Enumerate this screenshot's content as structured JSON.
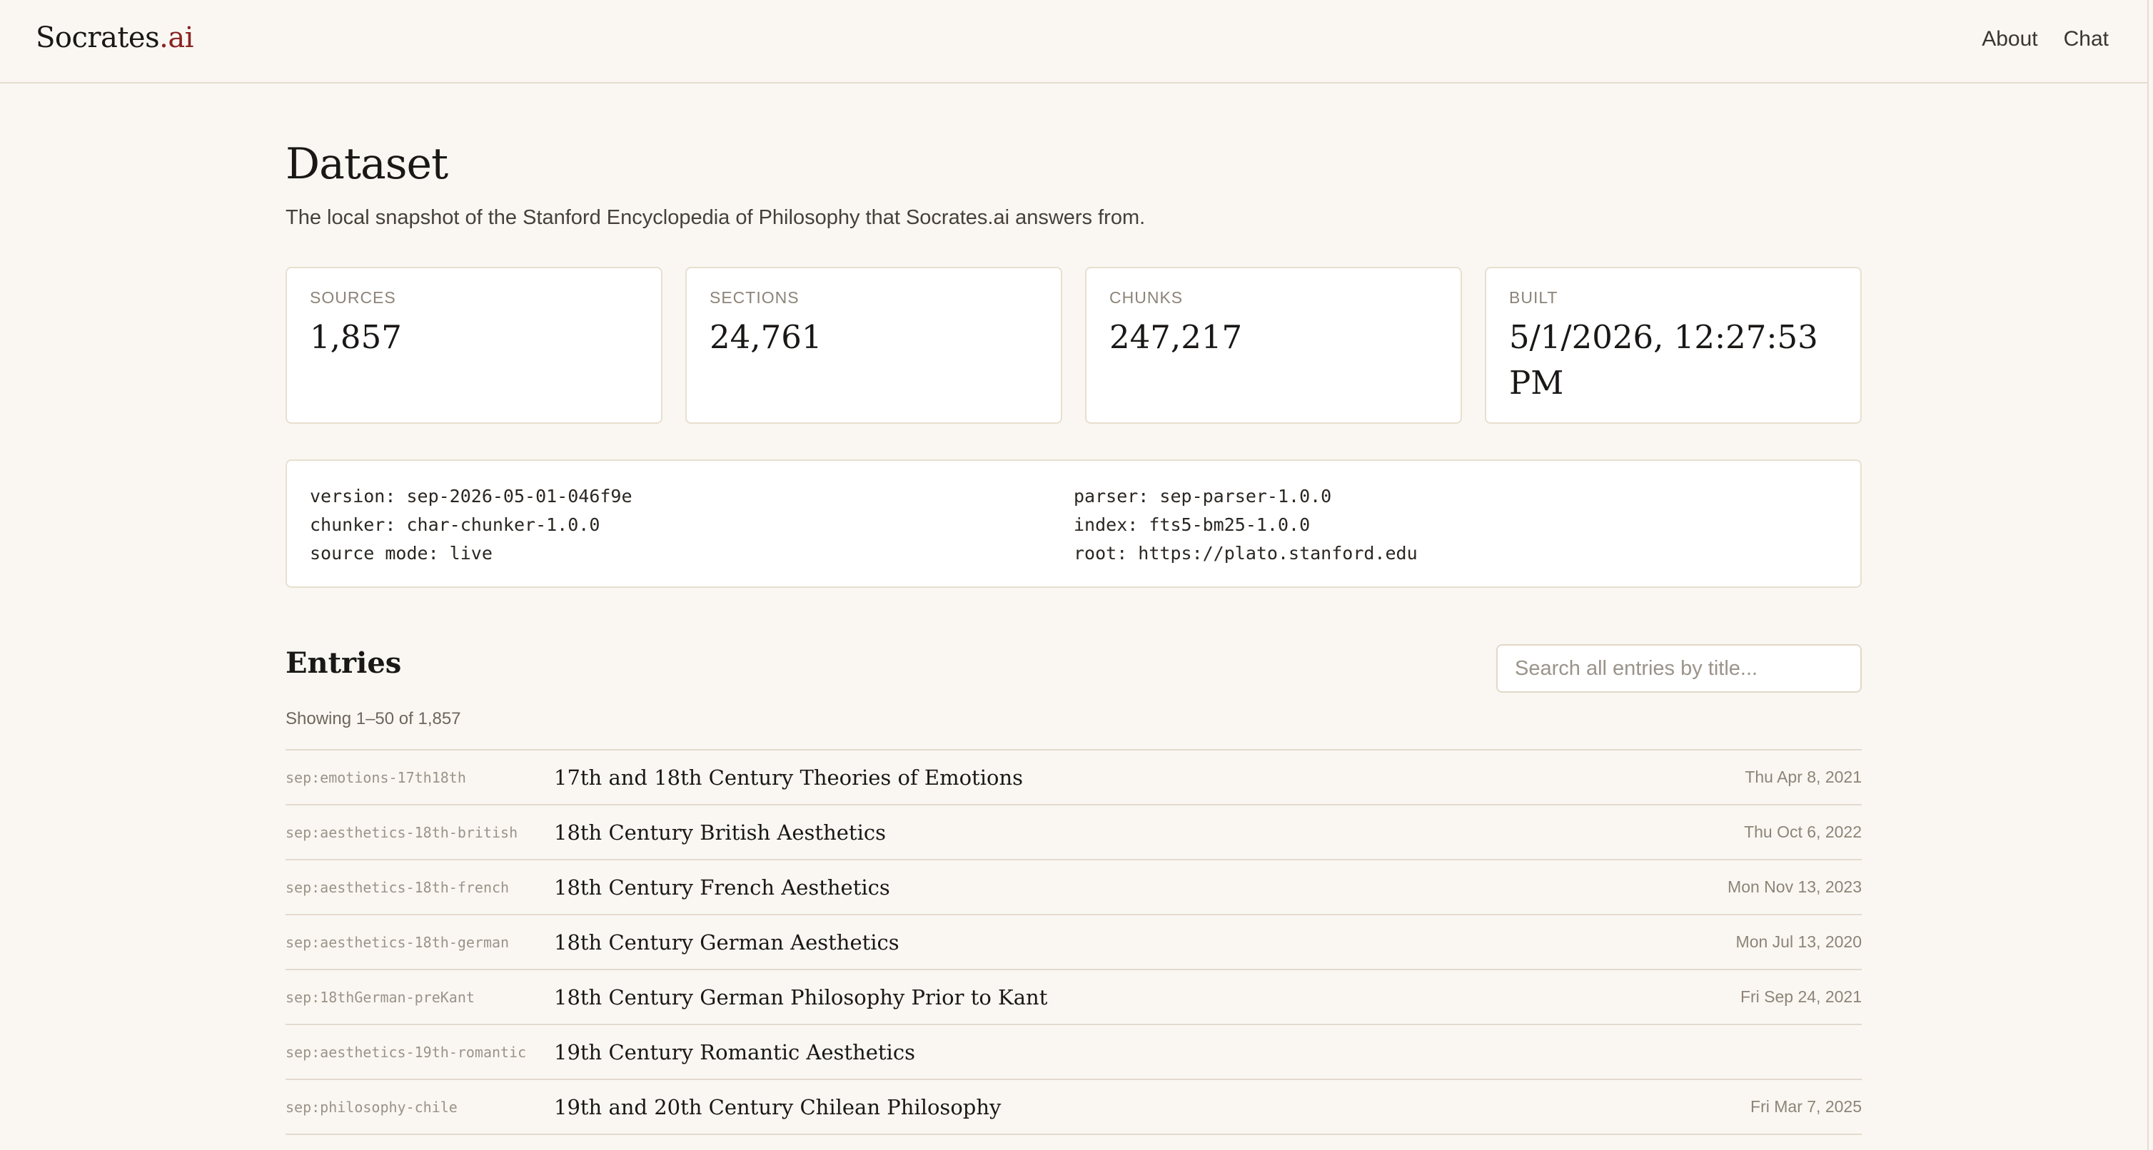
{
  "header": {
    "brand_main": "Socrates",
    "brand_accent": ".ai",
    "nav": [
      {
        "label": "About"
      },
      {
        "label": "Chat"
      }
    ]
  },
  "page": {
    "title": "Dataset",
    "subtitle": "The local snapshot of the Stanford Encyclopedia of Philosophy that Socrates.ai answers from."
  },
  "stats": [
    {
      "label": "SOURCES",
      "value": "1,857"
    },
    {
      "label": "SECTIONS",
      "value": "24,761"
    },
    {
      "label": "CHUNKS",
      "value": "247,217"
    },
    {
      "label": "BUILT",
      "value": "5/1/2026, 12:27:53 PM"
    }
  ],
  "meta": {
    "left": [
      "version: sep-2026-05-01-046f9e",
      "chunker: char-chunker-1.0.0",
      "source mode: live"
    ],
    "right": [
      "parser: sep-parser-1.0.0",
      "index: fts5-bm25-1.0.0",
      "root: https://plato.stanford.edu"
    ]
  },
  "entries_section": {
    "title": "Entries",
    "search_placeholder": "Search all entries by title...",
    "showing": "Showing 1–50 of 1,857"
  },
  "entries": [
    {
      "id": "sep:emotions-17th18th",
      "title": "17th and 18th Century Theories of Emotions",
      "date": "Thu Apr 8, 2021"
    },
    {
      "id": "sep:aesthetics-18th-british",
      "title": "18th Century British Aesthetics",
      "date": "Thu Oct 6, 2022"
    },
    {
      "id": "sep:aesthetics-18th-french",
      "title": "18th Century French Aesthetics",
      "date": "Mon Nov 13, 2023"
    },
    {
      "id": "sep:aesthetics-18th-german",
      "title": "18th Century German Aesthetics",
      "date": "Mon Jul 13, 2020"
    },
    {
      "id": "sep:18thGerman-preKant",
      "title": "18th Century German Philosophy Prior to Kant",
      "date": "Fri Sep 24, 2021"
    },
    {
      "id": "sep:aesthetics-19th-romantic",
      "title": "19th Century Romantic Aesthetics",
      "date": ""
    },
    {
      "id": "sep:philosophy-chile",
      "title": "19th and 20th Century Chilean Philosophy",
      "date": "Fri Mar 7, 2025"
    }
  ]
}
